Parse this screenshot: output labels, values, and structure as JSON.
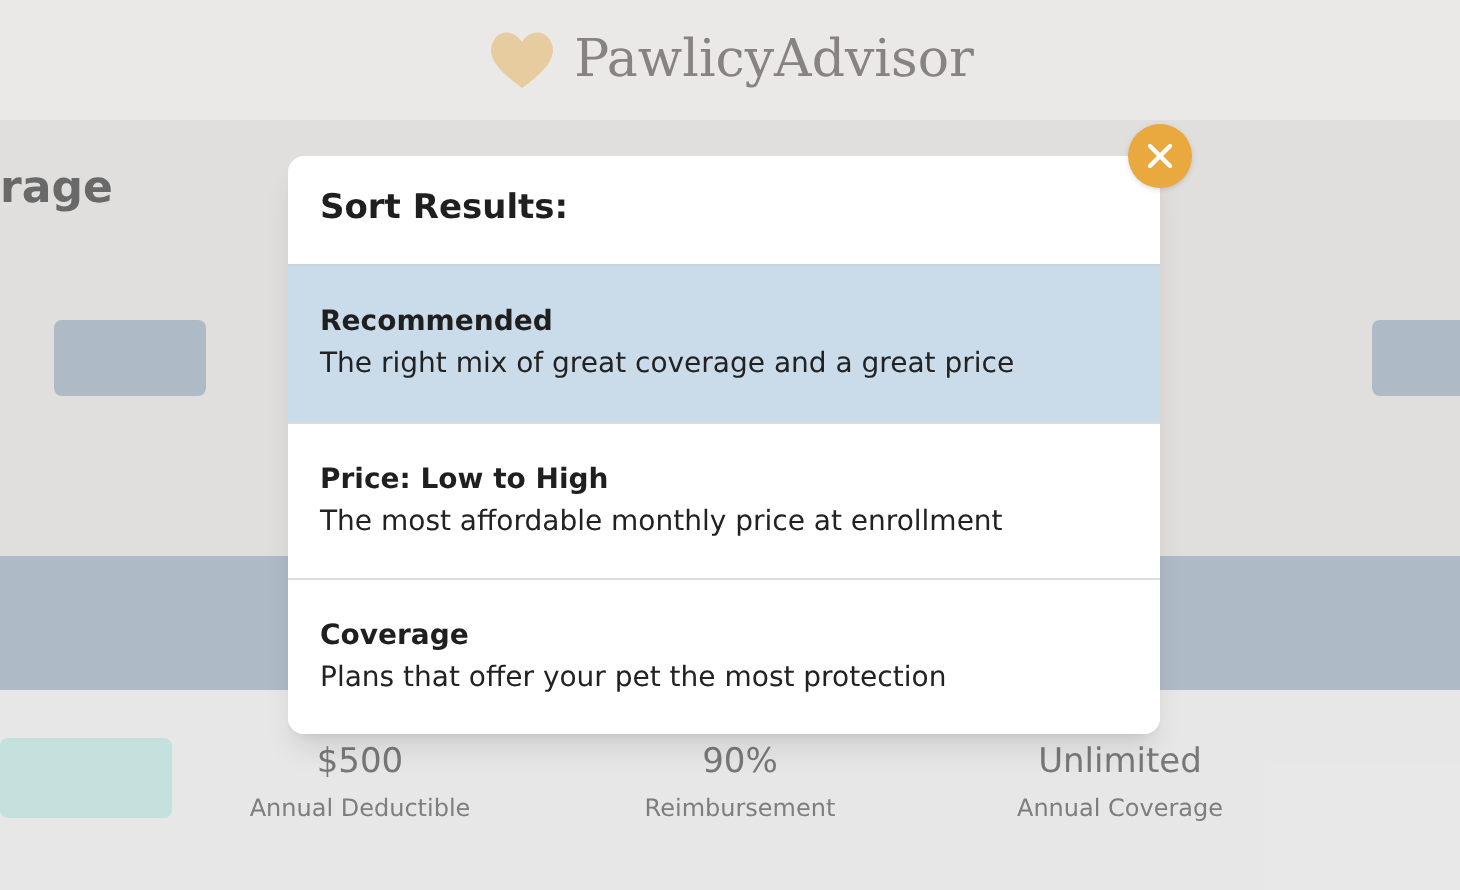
{
  "background": {
    "logo": "PawlicyAdvisor",
    "heading": "rage",
    "stats": [
      {
        "value": "$500",
        "label": "Annual Deductible"
      },
      {
        "value": "90%",
        "label": "Reimbursement"
      },
      {
        "value": "Unlimited",
        "label": "Annual Coverage"
      }
    ]
  },
  "modal": {
    "title": "Sort Results:",
    "options": [
      {
        "title": "Recommended",
        "description": "The right mix of great coverage and a great price",
        "selected": true
      },
      {
        "title": "Price: Low to High",
        "description": "The most affordable monthly price at enrollment",
        "selected": false
      },
      {
        "title": "Coverage",
        "description": "Plans that offer your pet the most protection",
        "selected": false
      }
    ]
  }
}
